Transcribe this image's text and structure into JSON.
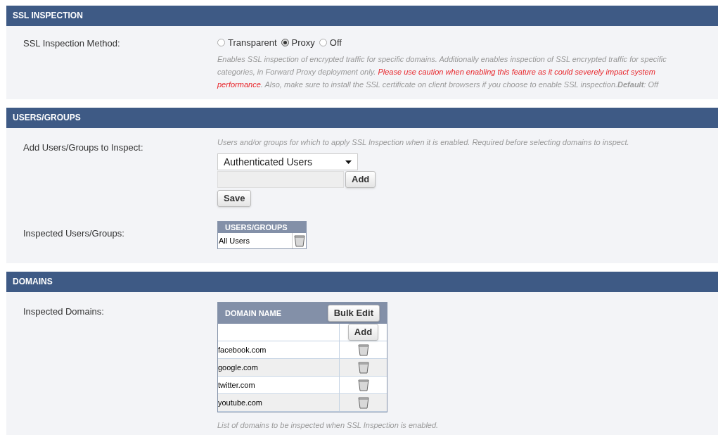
{
  "sections": [
    {
      "title": "SSL INSPECTION",
      "kind": "method",
      "label": "SSL Inspection Method:",
      "options": [
        {
          "label": "Transparent",
          "selected": false
        },
        {
          "label": "Proxy",
          "selected": true
        },
        {
          "label": "Off",
          "selected": false
        }
      ],
      "description": [
        {
          "kind": "normal",
          "text": "Enables SSL inspection of encrypted traffic for specific domains. Additionally enables inspection of SSL encrypted traffic for specific categories, in Forward Proxy deployment only. "
        },
        {
          "kind": "warning",
          "text": "Please use caution when enabling this feature as it could severely impact system performance"
        },
        {
          "kind": "normal",
          "text": ". Also, make sure to install the SSL certificate on client browsers if you choose to enable SSL inspection.**Default**: Off"
        }
      ]
    },
    {
      "title": "USERS/GROUPS",
      "kind": "users",
      "label": "Add Users/Groups to Inspect:",
      "hint": "Users and/or groups for which to apply SSL Inspection when it is enabled. Required before selecting domains to inspect.",
      "select_value": "Authenticated Users",
      "add_button": "Add",
      "save_button": "Save",
      "list_label": "Inspected Users/Groups:",
      "list_header": "USERS/GROUPS",
      "rows": [
        "All Users"
      ]
    },
    {
      "title": "DOMAINS",
      "kind": "domains",
      "label": "Inspected Domains:",
      "header": "DOMAIN NAME",
      "bulk_button": "Bulk Edit",
      "add_button": "Add",
      "rows": [
        "facebook.com",
        "google.com",
        "twitter.com",
        "youtube.com"
      ],
      "footnote": "List of domains to be inspected when SSL Inspection is enabled."
    }
  ]
}
